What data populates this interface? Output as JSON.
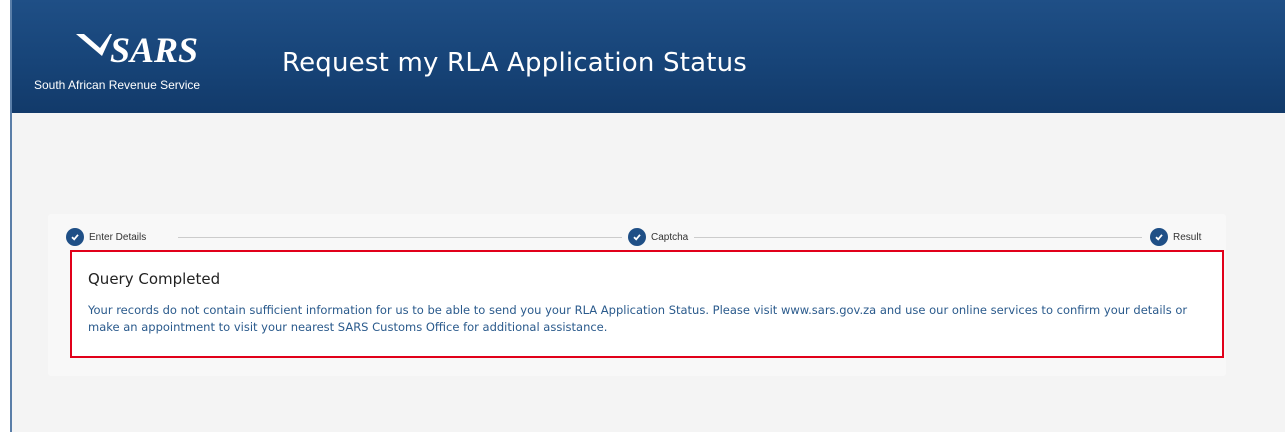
{
  "header": {
    "logo_text": "SARS",
    "logo_caption": "South African Revenue Service",
    "title": "Request my RLA Application Status"
  },
  "stepper": {
    "steps": [
      {
        "label": "Enter Details",
        "state": "complete"
      },
      {
        "label": "Captcha",
        "state": "complete"
      },
      {
        "label": "Result",
        "state": "complete"
      }
    ]
  },
  "result": {
    "title": "Query Completed",
    "message": "Your records do not contain sufficient information for us to be able to send you your RLA Application Status.  Please visit www.sars.gov.za and use our online services to confirm your details or make an appointment to visit your nearest SARS Customs Office for additional assistance."
  },
  "colors": {
    "brand_blue": "#1f4f86",
    "highlight_red": "#e1001a",
    "message_blue": "#2a5a8c"
  }
}
